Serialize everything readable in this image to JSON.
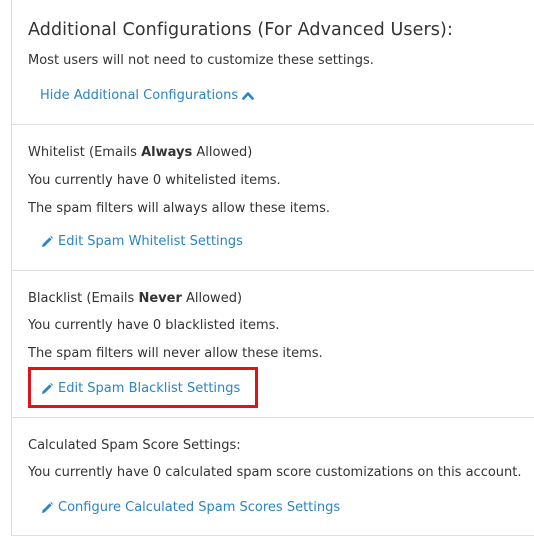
{
  "header": {
    "title": "Additional Configurations (For Advanced Users):",
    "subtitle": "Most users will not need to customize these settings.",
    "hide_link": "Hide Additional Configurations"
  },
  "whitelist": {
    "title_prefix": "Whitelist (Emails ",
    "title_bold": "Always",
    "title_suffix": " Allowed)",
    "line1": "You currently have 0 whitelisted items.",
    "line2": "The spam filters will always allow these items.",
    "edit_link": "Edit Spam Whitelist Settings"
  },
  "blacklist": {
    "title_prefix": "Blacklist (Emails ",
    "title_bold": "Never",
    "title_suffix": " Allowed)",
    "line1": "You currently have 0 blacklisted items.",
    "line2": "The spam filters will never allow these items.",
    "edit_link": "Edit Spam Blacklist Settings"
  },
  "calculated": {
    "title": "Calculated Spam Score Settings:",
    "line1": "You currently have 0 calculated spam score customizations on this account.",
    "config_link": "Configure Calculated Spam Scores Settings"
  },
  "colors": {
    "link": "#2a84c5",
    "highlight": "#e0121a",
    "text": "#333333",
    "border": "#dddddd"
  },
  "icons": {
    "edit": "pencil-icon",
    "collapse": "chevron-up-icon"
  }
}
